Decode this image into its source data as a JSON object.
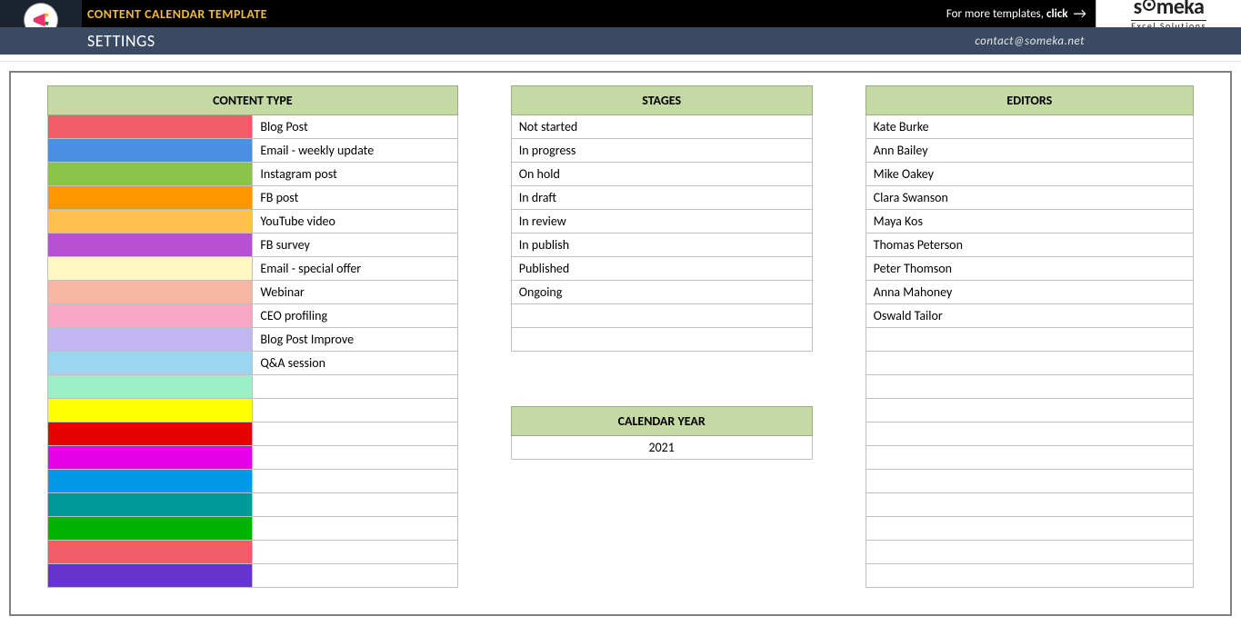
{
  "header": {
    "title": "CONTENT CALENDAR TEMPLATE",
    "more_templates": "For more templates,",
    "click": "click",
    "brand_main": "someka",
    "brand_sub": "Excel Solutions"
  },
  "subheader": {
    "section": "SETTINGS",
    "contact": "contact@someka.net"
  },
  "content_type": {
    "heading": "CONTENT TYPE",
    "rows": [
      {
        "color": "#f25b6a",
        "label": "Blog Post"
      },
      {
        "color": "#4a90e2",
        "label": "Email - weekly update"
      },
      {
        "color": "#8bc34a",
        "label": "Instagram post"
      },
      {
        "color": "#ff9800",
        "label": "FB post"
      },
      {
        "color": "#ffc04d",
        "label": "YouTube video"
      },
      {
        "color": "#b94fd1",
        "label": "FB survey"
      },
      {
        "color": "#fff7c2",
        "label": "Email - special offer"
      },
      {
        "color": "#f7b6a3",
        "label": "Webinar"
      },
      {
        "color": "#f7a6c4",
        "label": "CEO profiling"
      },
      {
        "color": "#c1b6f2",
        "label": "Blog Post Improve"
      },
      {
        "color": "#9ad6f0",
        "label": "Q&A session"
      },
      {
        "color": "#9cf0c9",
        "label": ""
      },
      {
        "color": "#ffff00",
        "label": ""
      },
      {
        "color": "#e60000",
        "label": ""
      },
      {
        "color": "#e600e6",
        "label": ""
      },
      {
        "color": "#0099e6",
        "label": ""
      },
      {
        "color": "#009999",
        "label": ""
      },
      {
        "color": "#00b300",
        "label": ""
      },
      {
        "color": "#f25b6a",
        "label": ""
      },
      {
        "color": "#6633cc",
        "label": ""
      }
    ]
  },
  "stages": {
    "heading": "STAGES",
    "rows": [
      "Not started",
      "In progress",
      "On hold",
      "In draft",
      "In review",
      "In publish",
      "Published",
      "Ongoing",
      "",
      ""
    ]
  },
  "calendar_year": {
    "heading": "CALENDAR YEAR",
    "value": "2021"
  },
  "editors": {
    "heading": "EDITORS",
    "rows": [
      "Kate Burke",
      "Ann Bailey",
      "Mike Oakey",
      "Clara Swanson",
      "Maya Kos",
      "Thomas Peterson",
      "Peter Thomson",
      "Anna Mahoney",
      "Oswald Tailor",
      "",
      "",
      "",
      "",
      "",
      "",
      "",
      "",
      "",
      "",
      ""
    ]
  }
}
